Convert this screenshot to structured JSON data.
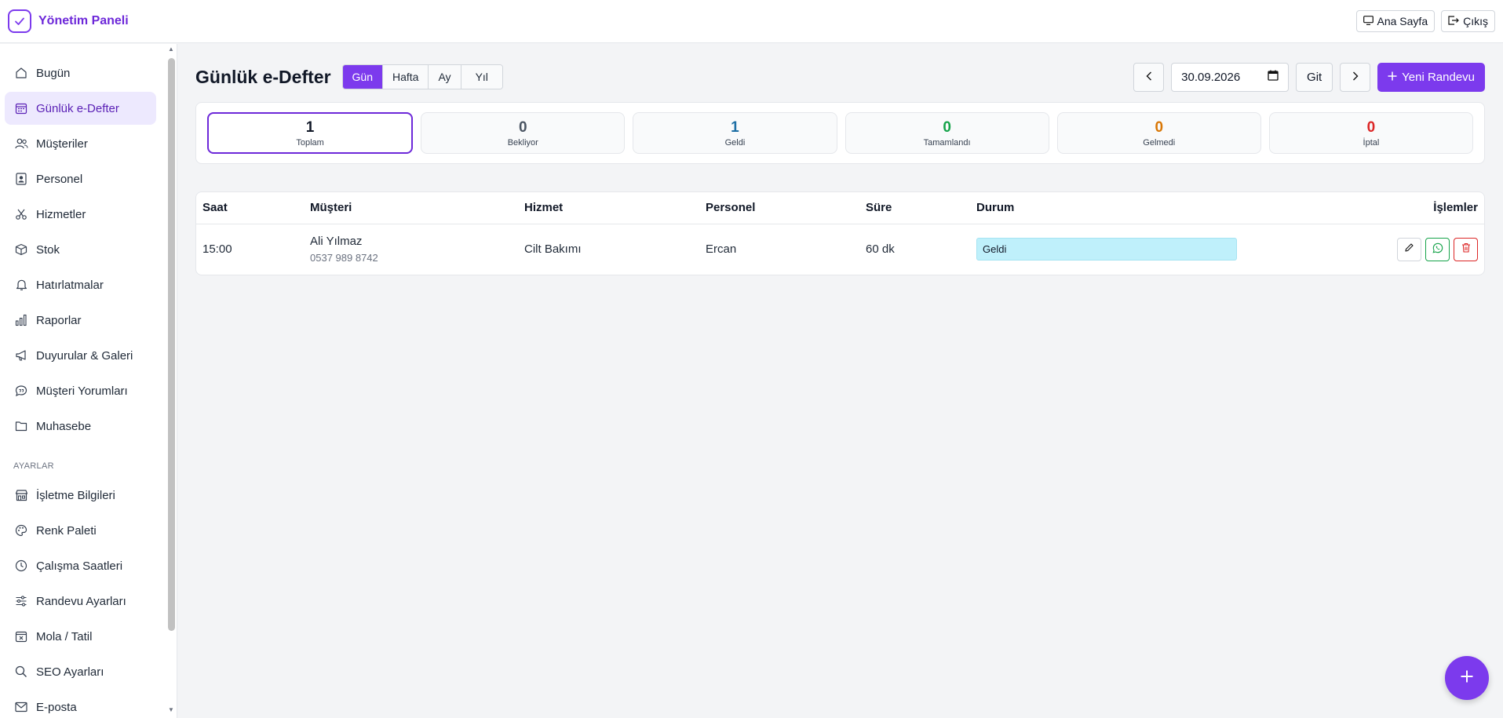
{
  "header": {
    "title": "Yönetim Paneli",
    "home_label": "Ana Sayfa",
    "logout_label": "Çıkış"
  },
  "sidebar": {
    "items": [
      {
        "label": "Bugün",
        "icon": "home-icon"
      },
      {
        "label": "Günlük e-Defter",
        "icon": "calendar-icon",
        "active": true
      },
      {
        "label": "Müşteriler",
        "icon": "users-icon"
      },
      {
        "label": "Personel",
        "icon": "badge-icon"
      },
      {
        "label": "Hizmetler",
        "icon": "scissors-icon"
      },
      {
        "label": "Stok",
        "icon": "box-icon"
      },
      {
        "label": "Hatırlatmalar",
        "icon": "bell-icon"
      },
      {
        "label": "Raporlar",
        "icon": "bar-chart-icon"
      },
      {
        "label": "Duyurular & Galeri",
        "icon": "megaphone-icon"
      },
      {
        "label": "Müşteri Yorumları",
        "icon": "chat-quote-icon"
      },
      {
        "label": "Muhasebe",
        "icon": "folder-icon"
      }
    ],
    "section_label": "AYARLAR",
    "settings_items": [
      {
        "label": "İşletme Bilgileri",
        "icon": "shop-icon"
      },
      {
        "label": "Renk Paleti",
        "icon": "palette-icon"
      },
      {
        "label": "Çalışma Saatleri",
        "icon": "clock-icon"
      },
      {
        "label": "Randevu Ayarları",
        "icon": "sliders-icon"
      },
      {
        "label": "Mola / Tatil",
        "icon": "calendar-x-icon"
      },
      {
        "label": "SEO Ayarları",
        "icon": "search-icon"
      },
      {
        "label": "E-posta",
        "icon": "envelope-icon"
      }
    ]
  },
  "main": {
    "title": "Günlük e-Defter",
    "tabs": [
      {
        "label": "Gün",
        "active": true
      },
      {
        "label": "Hafta"
      },
      {
        "label": "Ay"
      },
      {
        "label": "Yıl"
      }
    ],
    "date_value": "30.09.2026",
    "go_label": "Git",
    "new_label": "Yeni Randevu"
  },
  "stats": [
    {
      "value": "1",
      "label": "Toplam",
      "color": "#111827"
    },
    {
      "value": "0",
      "label": "Bekliyor",
      "color": "#4b5563"
    },
    {
      "value": "1",
      "label": "Geldi",
      "color": "#1d6fa5"
    },
    {
      "value": "0",
      "label": "Tamamlandı",
      "color": "#16a34a"
    },
    {
      "value": "0",
      "label": "Gelmedi",
      "color": "#d97706"
    },
    {
      "value": "0",
      "label": "İptal",
      "color": "#dc2626"
    }
  ],
  "table": {
    "headers": [
      "Saat",
      "Müşteri",
      "Hizmet",
      "Personel",
      "Süre",
      "Durum",
      "İşlemler"
    ],
    "rows": [
      {
        "time": "15:00",
        "customer": "Ali Yılmaz",
        "phone": "0537 989 8742",
        "service": "Cilt Bakımı",
        "staff": "Ercan",
        "duration": "60 dk",
        "status": "Geldi"
      }
    ]
  },
  "colors": {
    "accent": "#7c3aed",
    "status_geldi": "#bff0fb"
  }
}
